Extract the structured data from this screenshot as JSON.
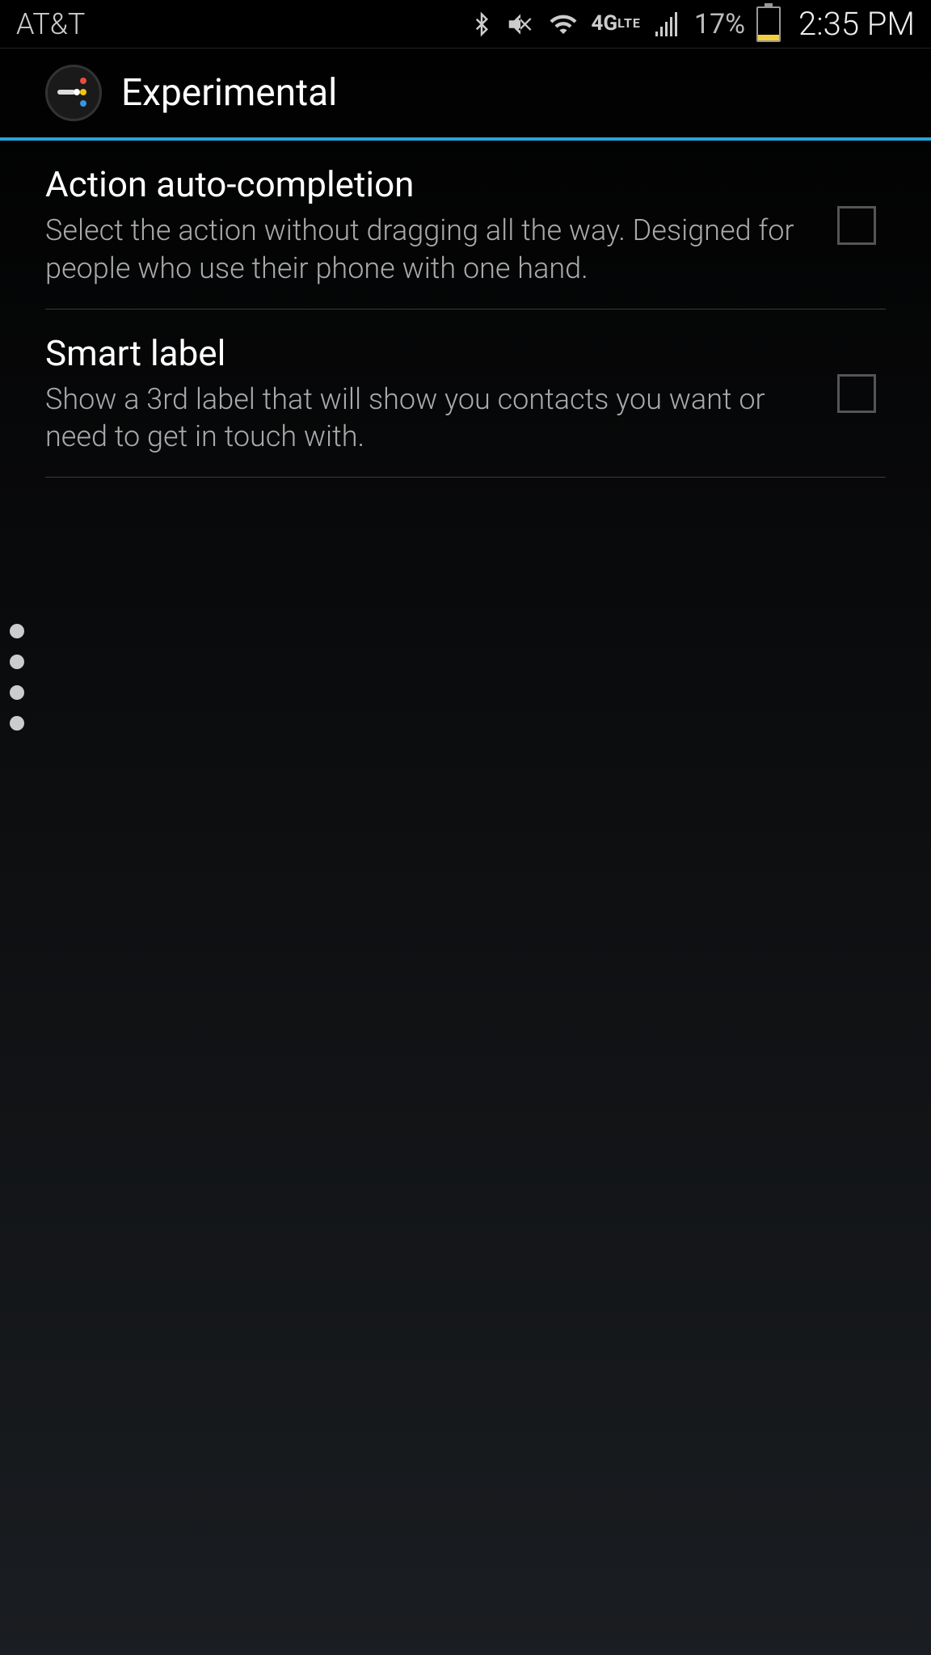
{
  "status_bar": {
    "carrier": "AT&T",
    "battery_percent": "17%",
    "time": "2:35 PM",
    "network_label": "4G LTE"
  },
  "header": {
    "title": "Experimental"
  },
  "settings": [
    {
      "title": "Action auto-completion",
      "description": "Select the action without dragging all the way. Designed for people who use their phone with one hand.",
      "checked": false
    },
    {
      "title": "Smart label",
      "description": "Show a 3rd label that will show you contacts you want or need to get in touch with.",
      "checked": false
    }
  ]
}
